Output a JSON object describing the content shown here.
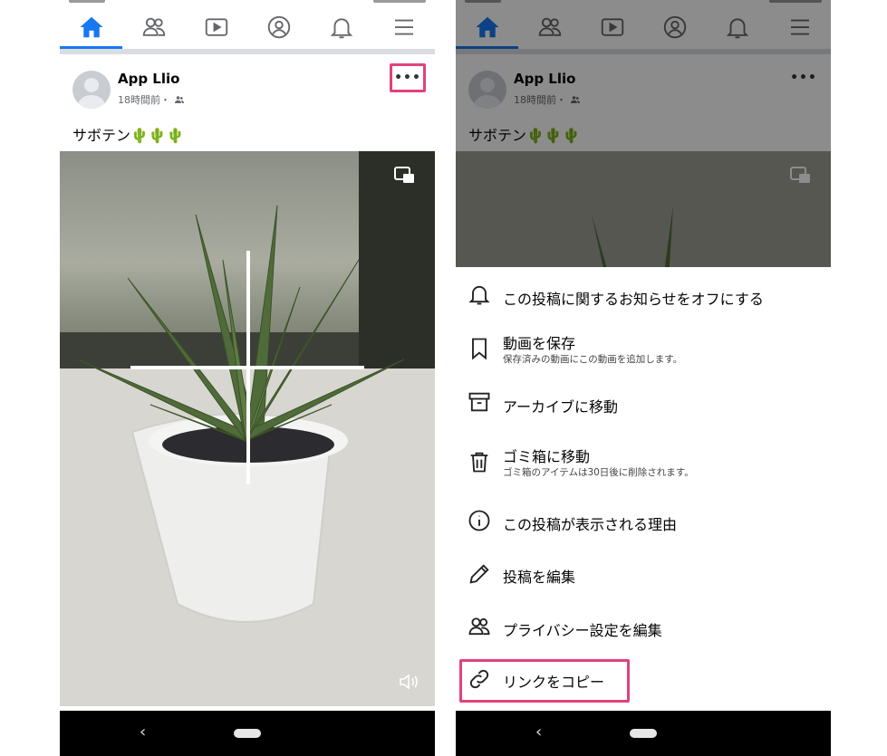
{
  "left": {
    "nav": [
      "home",
      "friends",
      "watch",
      "profile",
      "notifications",
      "menu"
    ],
    "post": {
      "author": "App Llio",
      "time": "18時間前・",
      "caption": "サボテン🌵🌵🌵",
      "more": "•••"
    },
    "sys": {
      "back": "‹"
    }
  },
  "right": {
    "post": {
      "author": "App Llio",
      "time": "18時間前・",
      "caption": "サボテン🌵🌵🌵",
      "more": "•••"
    },
    "menu": [
      {
        "icon": "bell-icon",
        "label": "この投稿に関するお知らせをオフにする",
        "sub": ""
      },
      {
        "icon": "bookmark-icon",
        "label": "動画を保存",
        "sub": "保存済みの動画にこの動画を追加します。"
      },
      {
        "icon": "archive-icon",
        "label": "アーカイブに移動",
        "sub": ""
      },
      {
        "icon": "trash-icon",
        "label": "ゴミ箱に移動",
        "sub": "ゴミ箱のアイテムは30日後に削除されます。"
      },
      {
        "icon": "info-icon",
        "label": "この投稿が表示される理由",
        "sub": ""
      },
      {
        "icon": "pencil-icon",
        "label": "投稿を編集",
        "sub": ""
      },
      {
        "icon": "people-icon",
        "label": "プライバシー設定を編集",
        "sub": ""
      },
      {
        "icon": "link-icon",
        "label": "リンクをコピー",
        "sub": ""
      }
    ],
    "sys": {
      "back": "‹"
    }
  },
  "colors": {
    "accent": "#1877f2",
    "highlight": "#e2417d",
    "dim": "rgba(0,0,0,0.45)"
  }
}
